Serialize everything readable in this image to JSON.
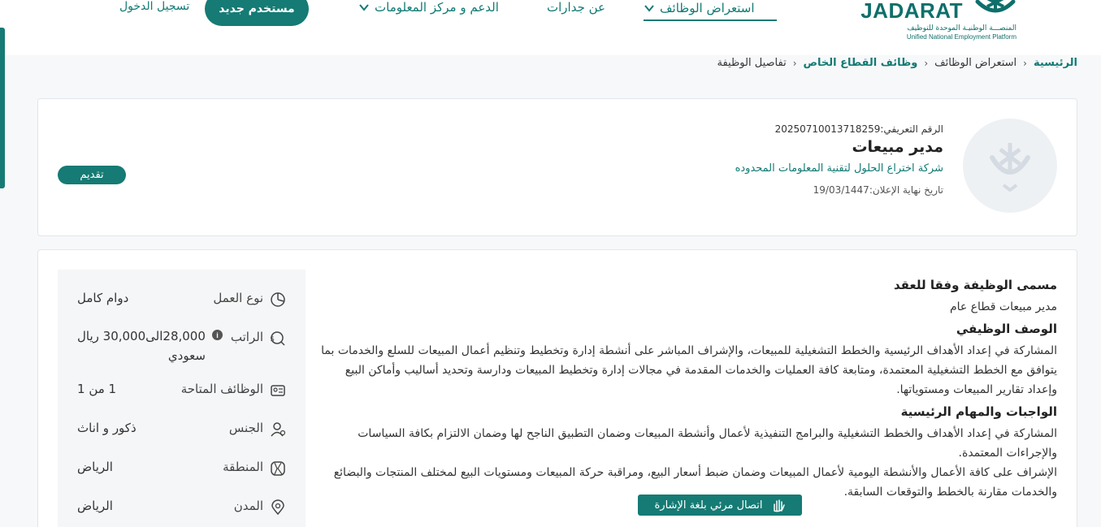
{
  "header": {
    "logo_word": "JADARAT",
    "logo_ar": "المنصـــة الوطنيـة الموحدة للتوظيف",
    "logo_en": "Unified National Employment Platform",
    "nav": {
      "browse_jobs": "استعراض الوظائف",
      "about": "عن جدارات",
      "support": "الدعم و مركز المعلومات"
    },
    "new_user": "مستخدم جديد",
    "login": "تسجيل الدخول"
  },
  "breadcrumb": [
    "الرئيسية",
    "استعراض الوظائف",
    "وظائف القطاع الخاص",
    "تفاصيل الوظيفة"
  ],
  "job": {
    "id_line": "الرقم التعريفي:20250710013718259",
    "title": "مدير مبيعات",
    "company": "شركة اختراع الحلول لتقنية المعلومات المحدوده",
    "deadline": "تاريخ نهاية الإعلان:19/03/1447",
    "apply": "تقديم"
  },
  "details": [
    {
      "label": "نوع العمل",
      "value": "دوام كامل",
      "icon": "clock-icon"
    },
    {
      "label": "الراتب",
      "value": "28,000الى30,000 ريال سعودي",
      "icon": "salary-icon"
    },
    {
      "label": "الوظائف المتاحة",
      "value": "1 من 1",
      "icon": "id-card-icon"
    },
    {
      "label": "الجنس",
      "value": "ذكور و اناث",
      "icon": "person-icon"
    },
    {
      "label": "المنطقة",
      "value": "الرياض",
      "icon": "map-icon"
    },
    {
      "label": "المدن",
      "value": "الرياض",
      "icon": "location-pin-icon"
    }
  ],
  "salary_line1": "28,000الى30,000 ريال",
  "salary_line2": "سعودي",
  "description": {
    "contract_title_heading": "مسمى الوظيفة وفقا للعقد",
    "contract_title": "مدير مبيعات قطاع عام",
    "job_desc_heading": "الوصف الوظيفي",
    "job_desc": "المشاركة في إعداد الأهداف الرئيسية والخطط التشغيلية للمبيعات، والإشراف المباشر على أنشطة إدارة وتخطيط وتنظيم أعمال المبيعات للسلع والخدمات بما يتوافق مع الخطط التشغيلية المعتمدة، ومتابعة كافة العمليات والخدمات المقدمة في مجالات إدارة وتخطيط المبيعات ودارسة وتحديد أساليب وأماكن البيع وإعداد تقارير المبيعات ومستوياتها.",
    "duties_heading": "الواجبات والمهام الرئيسية",
    "duty1": "المشاركة في إعداد الأهداف والخطط التشغيلية والبرامج التنفيذية لأعمال وأنشطة المبيعات وضمان التطبيق الناجح لها وضمان الالتزام بكافة السياسات والإجراءات المعتمدة.",
    "duty2": "الإشراف على كافة الأعمال والأنشطة اليومية لأعمال المبيعات وضمان ضبط أسعار البيع، ومراقبة حركة المبيعات ومستويات البيع لمختلف المنتجات والبضائع والخدمات مقارنة بالخطط والتوقعات السابقة."
  },
  "sign_language": "اتصال مرئي بلغة الإشارة"
}
